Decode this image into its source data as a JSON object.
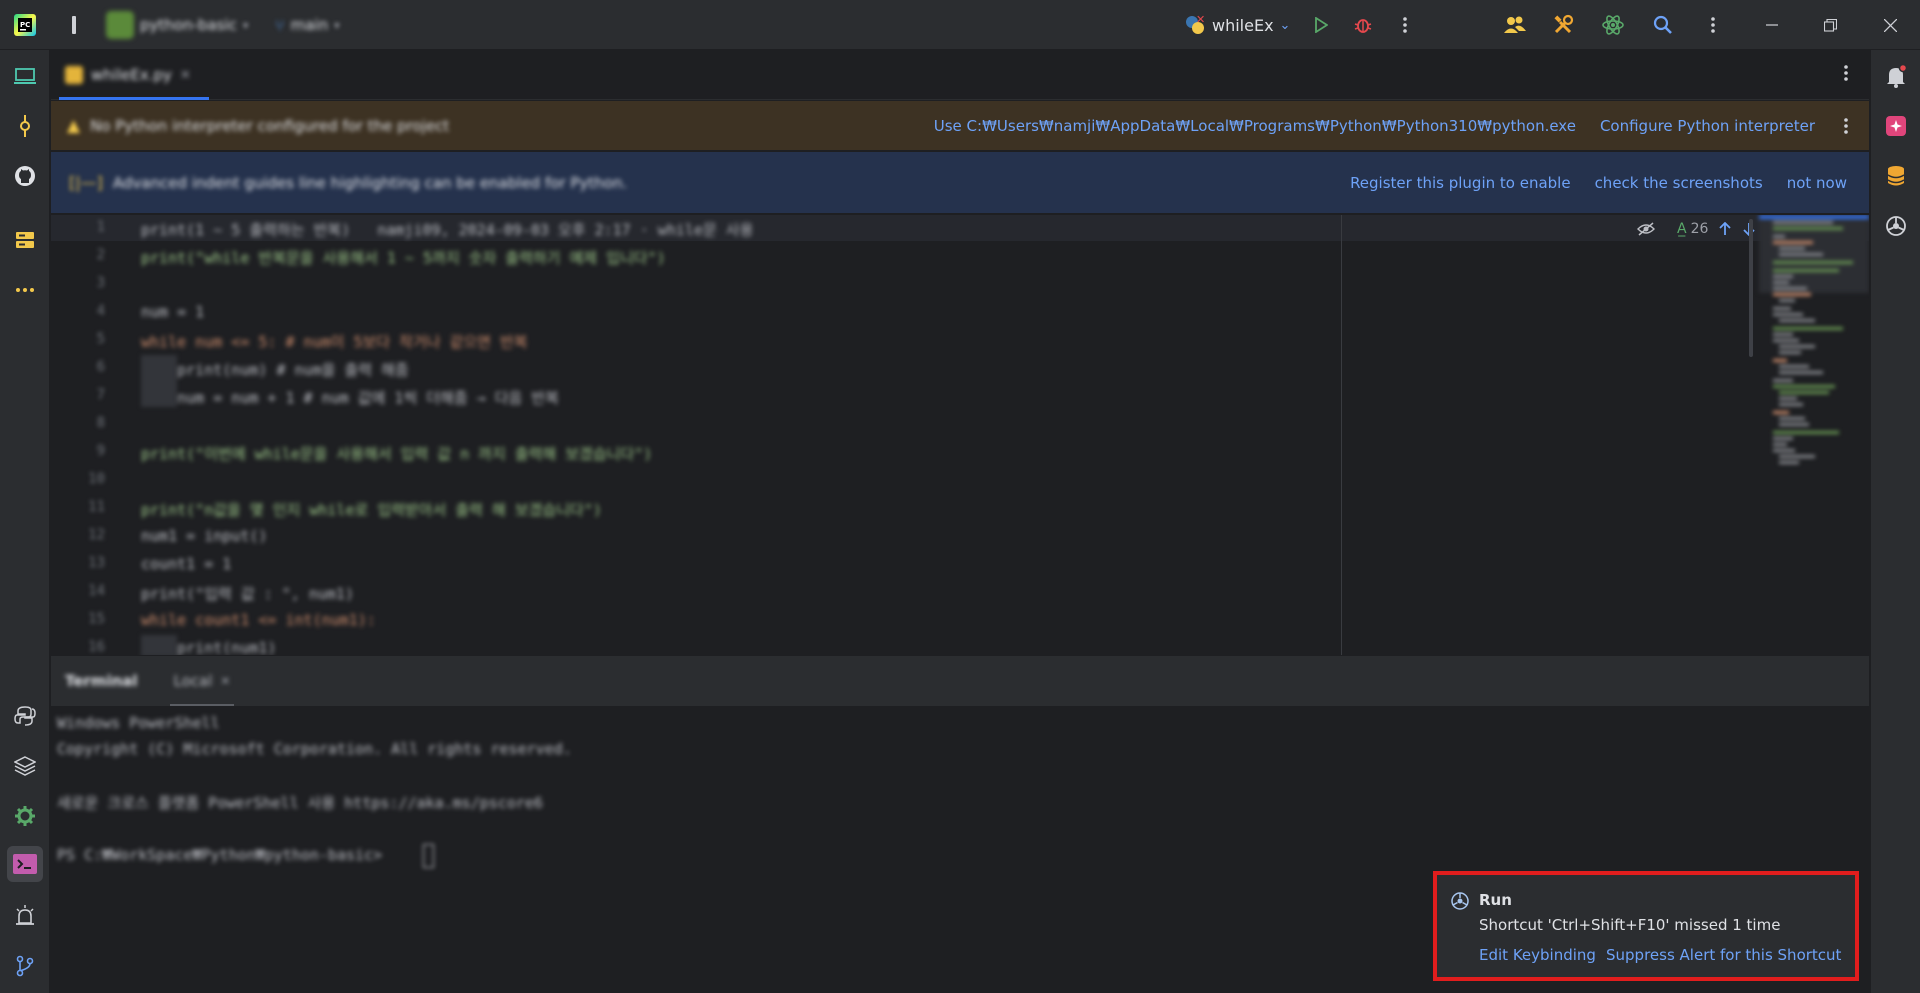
{
  "titlebar": {
    "project_name": "python-basic",
    "branch_name": "main",
    "run_config": "whileEx"
  },
  "editor_tab": {
    "file_name": "whileEx.py"
  },
  "interpreter_banner": {
    "message": "No Python interpreter configured for the project",
    "use_interpreter_link": "Use C:₩Users₩namji₩AppData₩Local₩Programs₩Python₩Python310₩python.exe",
    "configure_link": "Configure Python interpreter"
  },
  "plugin_banner": {
    "message": "Advanced indent guides line highlighting can be enabled for Python.",
    "register_link": "Register this plugin to enable",
    "screenshots_link": "check the screenshots",
    "not_now_link": "not now"
  },
  "inspection_widget": {
    "typo_count": "26"
  },
  "code": {
    "line_numbers": [
      "1",
      "2",
      "3",
      "4",
      "5",
      "6",
      "7",
      "8",
      "9",
      "10",
      "11",
      "12",
      "13",
      "14",
      "15",
      "16"
    ],
    "lines": [
      "print(1 ~ 5 출력하는 반복)   namji09, 2024-09-03 오후 2:17 · while문 사용",
      "print(\"while 반복문을 사용해서 1 ~ 5까지 숫자 출력하기 예제 입니다\")",
      "",
      "num = 1",
      "while num <= 5: # num이 5보다 작거나 같으면 반복",
      "    print(num) # num을 출력 해줌",
      "    num = num + 1 # num 값에 1씩 더해줌 → 다음 반복",
      "",
      "print(\"이번에 while문을 사용해서 입력 값 n 까지 출력해 보겠습니다\")",
      "",
      "print(\"n값을 몇 인지 while로 입력받아서 출력 해 보겠습니다\")",
      "num1 = input()",
      "count1 = 1",
      "print(\"입력 값 : \", num1)",
      "while count1 <= int(num1):",
      "    print(num1)"
    ]
  },
  "terminal": {
    "tab_terminal": "Terminal",
    "tab_local": "Local",
    "lines": [
      "Windows PowerShell",
      "Copyright (C) Microsoft Corporation. All rights reserved.",
      "",
      "새로운 크로스 플랫폼 PowerShell 사용 https://aka.ms/pscore6",
      "",
      "PS C:₩WorkSpace₩Python₩python-basic> "
    ]
  },
  "notification": {
    "title": "Run",
    "message": "Shortcut 'Ctrl+Shift+F10' missed 1 time",
    "edit_link": "Edit Keybinding",
    "suppress_link": "Suppress Alert for this Shortcut"
  },
  "colors": {
    "accent_blue": "#3574f0",
    "link_blue": "#6ea2f7",
    "highlight_red": "#e11d1d",
    "warning_banner": "#3d3223",
    "plugin_banner": "#25324d"
  }
}
